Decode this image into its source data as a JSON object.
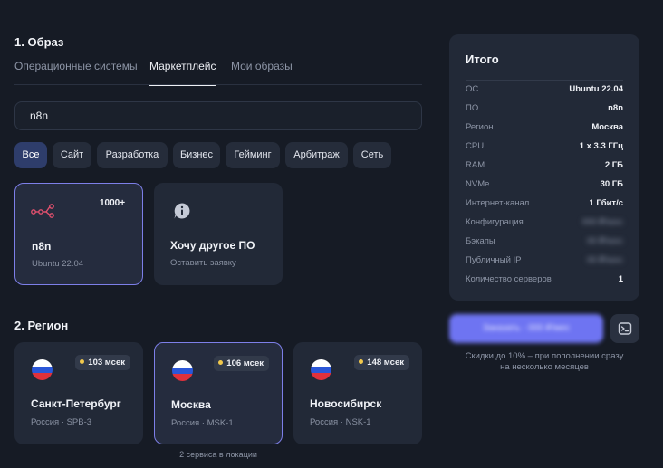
{
  "section1": {
    "title": "1. Образ"
  },
  "tabs": [
    {
      "label": "Операционные системы",
      "active": false
    },
    {
      "label": "Маркетплейс",
      "active": true
    },
    {
      "label": "Мои образы",
      "active": false
    }
  ],
  "search": {
    "value": "n8n"
  },
  "categories": [
    "Все",
    "Сайт",
    "Разработка",
    "Бизнес",
    "Гейминг",
    "Арбитраж",
    "Сеть"
  ],
  "apps": [
    {
      "name": "n8n",
      "sub": "Ubuntu 22.04",
      "badge": "1000+",
      "icon": "share-nodes-icon",
      "icon_color": "#e0506e",
      "selected": true
    },
    {
      "name": "Хочу другое ПО",
      "sub": "Оставить заявку",
      "icon": "info-bubble-icon",
      "icon_color": "#c5cad6",
      "selected": false
    }
  ],
  "section2": {
    "title": "2. Регион"
  },
  "regions": [
    {
      "city": "Санкт-Петербург",
      "code": "Россия · SPB-3",
      "ping": "103 мсек",
      "selected": false
    },
    {
      "city": "Москва",
      "code": "Россия · MSK-1",
      "ping": "106 мсек",
      "selected": true
    },
    {
      "city": "Новосибирск",
      "code": "Россия · NSK-1",
      "ping": "148 мсек",
      "selected": false
    }
  ],
  "region_note": "2 сервиса в локации",
  "summary": {
    "title": "Итого",
    "rows": [
      {
        "k": "ОС",
        "v": "Ubuntu 22.04"
      },
      {
        "k": "ПО",
        "v": "n8n"
      },
      {
        "k": "Регион",
        "v": "Москва"
      },
      {
        "k": "CPU",
        "v": "1 x 3.3 ГГц"
      },
      {
        "k": "RAM",
        "v": "2 ГБ"
      },
      {
        "k": "NVMe",
        "v": "30 ГБ"
      },
      {
        "k": "Интернет-канал",
        "v": "1 Гбит/с"
      },
      {
        "k": "Конфигурация",
        "v": "000 ₽/мес",
        "blurred": true
      },
      {
        "k": "Бэкапы",
        "v": "00 ₽/мес",
        "blurred": true
      },
      {
        "k": "Публичный IP",
        "v": "00 ₽/мес",
        "blurred": true
      },
      {
        "k": "Количество серверов",
        "v": "1"
      }
    ]
  },
  "order_button": "Заказать · 000 ₽/мес",
  "discount_text": [
    "Скидки до 10% – при пополнении сразу",
    "на несколько месяцев"
  ],
  "colors": {
    "accent": "#6e74f2",
    "selected_border": "#7d7fe8",
    "ping_dot": "#f2c94c"
  }
}
